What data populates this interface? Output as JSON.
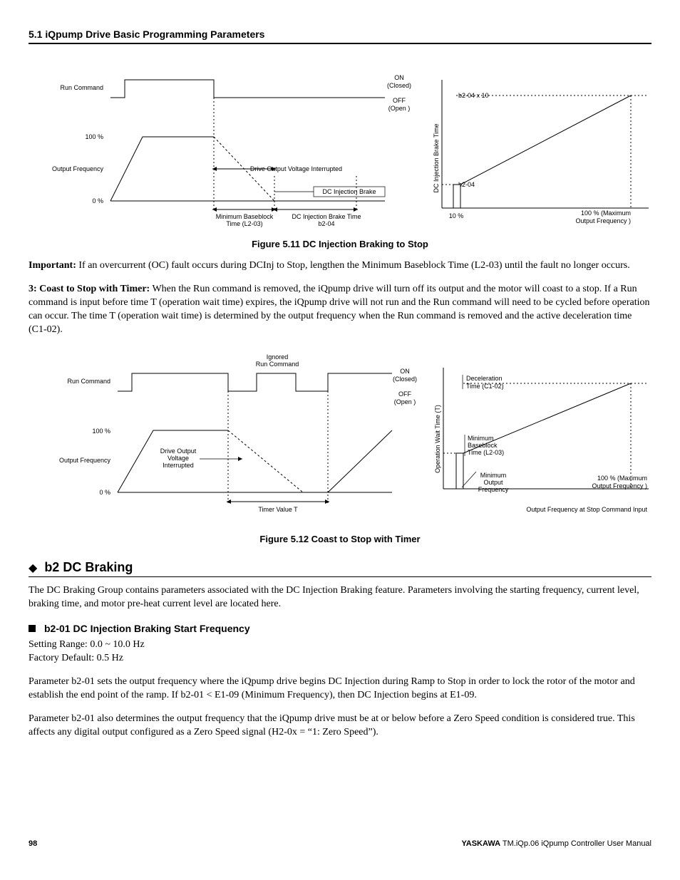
{
  "header": {
    "title": "5.1  iQpump Drive Basic Programming Parameters"
  },
  "fig511": {
    "caption": "Figure 5.11  DC Injection Braking to Stop",
    "left": {
      "runCommand": "Run Command",
      "pct100": "100 %",
      "outputFreq": "Output Frequency",
      "pct0": "0 %",
      "on": "ON",
      "closed": "(Closed)",
      "off": "OFF",
      "open": "(Open )",
      "interrupted": "Drive Output Voltage Interrupted",
      "dcBrake": "DC Injection Brake",
      "minBaseblock1": "Minimum Baseblock",
      "minBaseblock2": "Time (L2-03)",
      "dcBrakeTime1": "DC Injection Brake Time",
      "dcBrakeTime2": "b2-04"
    },
    "right": {
      "yaxis": "DC Injection Brake Time",
      "b204x10": "b2-04 x 10",
      "b204": "b2-04",
      "x10": "10 %",
      "x100a": "100 % (Maximum",
      "x100b": "Output Frequency )"
    }
  },
  "paraImportant": {
    "label": "Important:",
    "text": " If an overcurrent (OC) fault occurs during DCInj to Stop, lengthen the Minimum Baseblock Time (L2-03) until the fault no longer occurs."
  },
  "paraCoast": {
    "label": "3: Coast to Stop with Timer:",
    "text": " When the Run command is removed, the iQpump drive will turn off its output and the motor will coast to a stop. If a Run command is input before time T (operation wait time) expires, the iQpump drive will not run and the Run command will need to be cycled before operation can occur. The time T (operation wait time) is determined by the output frequency when the Run command is removed and the active deceleration time (C1-02)."
  },
  "fig512": {
    "caption": "Figure 5.12  Coast to Stop with Timer",
    "left": {
      "ignored1": "Ignored",
      "ignored2": "Run Command",
      "runCommand": "Run Command",
      "pct100": "100 %",
      "outputFreq": "Output Frequency",
      "pct0": "0 %",
      "on": "ON",
      "closed": "(Closed)",
      "off": "OFF",
      "open": "(Open )",
      "dov1": "Drive Output",
      "dov2": "Voltage",
      "dov3": "Interrupted",
      "timerValue": "Timer Value T"
    },
    "right": {
      "yaxis": "Operation Wait Time (T)",
      "decel1": "Deceleration",
      "decel2": "Time (C1-02)",
      "minbb1": "Minimum",
      "minbb2": "Baseblock",
      "minbb3": "Time (L2-03)",
      "minOut1": "Minimum",
      "minOut2": "Output",
      "minOut3": "Frequency",
      "x100a": "100 % (Maximum",
      "x100b": "Output Frequency )",
      "xlabel": "Output Frequency at Stop Command Input"
    }
  },
  "sectionB2": {
    "title": "b2 DC Braking",
    "intro": "The DC Braking Group contains parameters associated with the DC Injection Braking feature. Parameters involving the starting frequency, current level, braking time, and motor pre-heat current level are located here."
  },
  "b201": {
    "title": "b2-01 DC Injection Braking Start Frequency",
    "range": "Setting Range:  0.0 ~ 10.0 Hz",
    "default": "Factory Default: 0.5 Hz",
    "p1": "Parameter b2-01 sets the output frequency where the iQpump drive begins DC Injection during Ramp to Stop in order to lock the rotor of the motor and establish the end point of the ramp. If b2-01 < E1-09 (Minimum Frequency), then DC Injection begins at E1-09.",
    "p2": "Parameter b2-01 also determines the output frequency that the iQpump drive must be at or below before a Zero Speed condition is considered true. This affects any digital output configured as a Zero Speed signal (H2-0x = “1: Zero Speed”)."
  },
  "footer": {
    "page": "98",
    "brand": "YASKAWA",
    "manual": " TM.iQp.06 iQpump Controller User Manual"
  }
}
